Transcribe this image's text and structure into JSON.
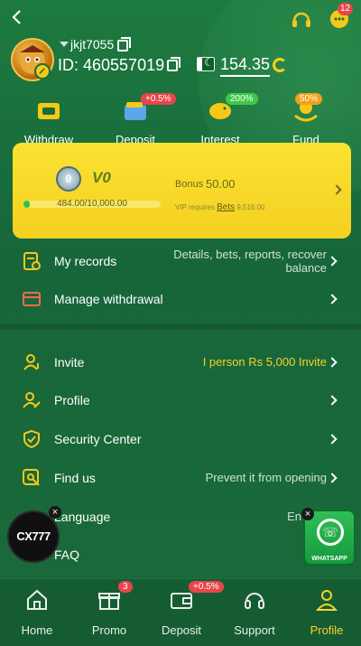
{
  "header": {
    "username": "jkjt7055",
    "user_id": "ID: 460557019",
    "balance": "154.35",
    "message_count": "12"
  },
  "quick_actions": [
    {
      "label": "Withdraw",
      "tag": ""
    },
    {
      "label": "Deposit",
      "tag": "+0.5%"
    },
    {
      "label": "Interest",
      "tag": "200%"
    },
    {
      "label": "Fund",
      "tag": "50%"
    }
  ],
  "vip": {
    "badge": "0",
    "level": "V0",
    "progress_text": "484.00/10,000.00",
    "progress_fraction": 0.0484,
    "bonus_label": "Bonus",
    "bonus_value": "50.00",
    "req_prefix": "VIP requires",
    "req_link": "Bets",
    "req_value": "9,516.00"
  },
  "rows": {
    "records_label": "My records",
    "records_value_1": "Details, bets, reports, recover",
    "records_value_2": "balance",
    "withdrawal_label": "Manage withdrawal",
    "invite_label": "Invite",
    "invite_value": "I person Rs 5,000 Invite",
    "profile_label": "Profile",
    "security_label": "Security Center",
    "findus_label": "Find us",
    "findus_value": "Prevent it from opening",
    "language_label": "Language",
    "language_value": "En",
    "faq_label": "FAQ"
  },
  "floating": {
    "cx_text": "CX777",
    "wa_text": "WHATSAPP",
    "close": "×"
  },
  "nav": [
    {
      "label": "Home",
      "badge": ""
    },
    {
      "label": "Promo",
      "badge": "3"
    },
    {
      "label": "Deposit",
      "badge": "+0.5%"
    },
    {
      "label": "Support",
      "badge": ""
    },
    {
      "label": "Profile",
      "badge": ""
    }
  ],
  "colors": {
    "accent": "#f6d22b",
    "background": "#1c6b3a",
    "badge": "#e8454a"
  }
}
